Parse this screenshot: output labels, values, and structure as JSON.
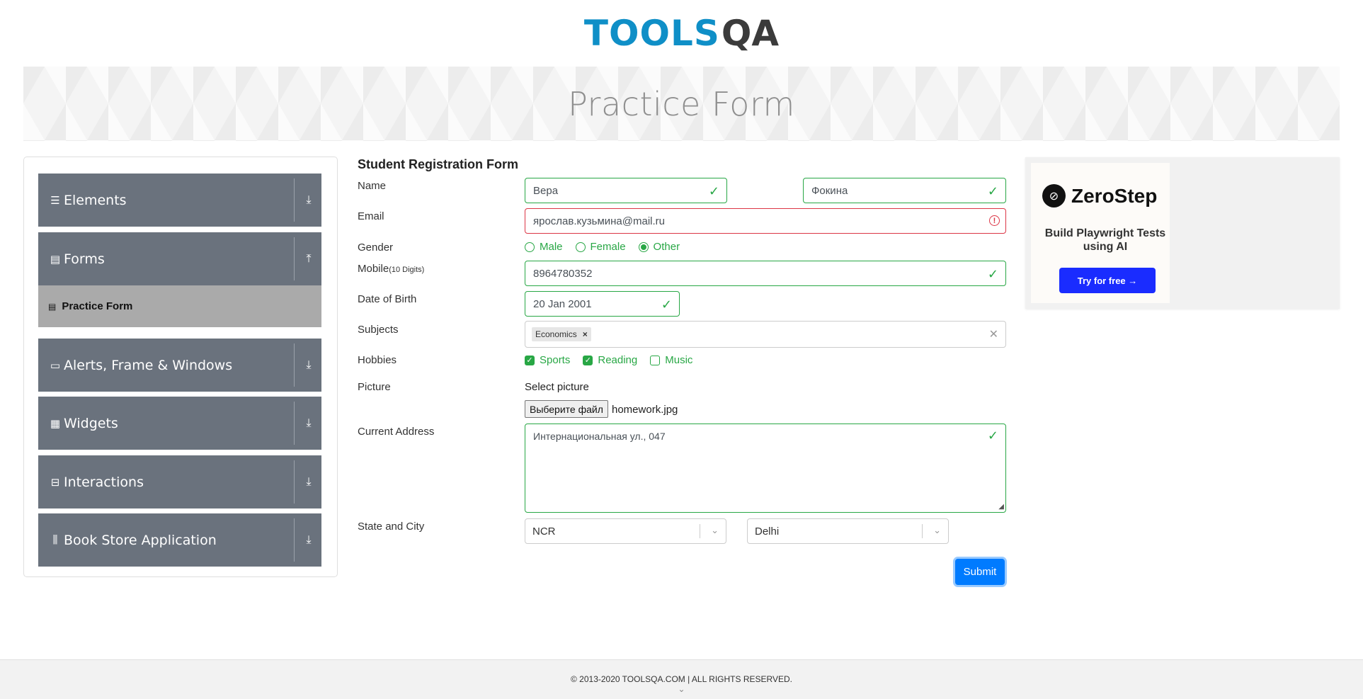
{
  "logo": {
    "text": "TOOLS",
    "qa": "QA"
  },
  "banner": {
    "title": "Practice Form"
  },
  "sidebar": {
    "groups": [
      {
        "label": "Elements",
        "icon": "☰",
        "arrow": "⤓"
      },
      {
        "label": "Forms",
        "icon": "▤",
        "arrow": "⤒"
      },
      {
        "label": "Alerts, Frame & Windows",
        "icon": "▭",
        "arrow": "⤓"
      },
      {
        "label": "Widgets",
        "icon": "▦",
        "arrow": "⤓"
      },
      {
        "label": "Interactions",
        "icon": "⊟",
        "arrow": "⤓"
      },
      {
        "label": "Book Store Application",
        "icon": "⫼",
        "arrow": "⤓"
      }
    ],
    "active_item": {
      "label": "Practice Form",
      "icon": "▤"
    }
  },
  "form": {
    "title": "Student Registration Form",
    "labels": {
      "name": "Name",
      "email": "Email",
      "gender": "Gender",
      "mobile": "Mobile",
      "mobile_hint": "(10 Digits)",
      "dob": "Date of Birth",
      "subjects": "Subjects",
      "hobbies": "Hobbies",
      "picture": "Picture",
      "address": "Current Address",
      "state_city": "State and City"
    },
    "first_name": "Вера",
    "last_name": "Фокина",
    "email": "ярослав.кузьмина@mail.ru",
    "gender_options": {
      "male": "Male",
      "female": "Female",
      "other": "Other"
    },
    "gender_selected": "Other",
    "mobile": "8964780352",
    "dob": "20 Jan 2001",
    "subject_chip": "Economics",
    "hobbies": {
      "sports": "Sports",
      "reading": "Reading",
      "music": "Music"
    },
    "hobbies_checked": [
      "Sports",
      "Reading"
    ],
    "picture_label": "Select picture",
    "file_button": "Выберите файл",
    "file_name": "homework.jpg",
    "address": "Интернациональная ул., 047",
    "state": "NCR",
    "city": "Delhi",
    "submit": "Submit"
  },
  "ad": {
    "brand": "ZeroStep",
    "copy": "Build Playwright Tests using AI",
    "button": "Try for free →"
  },
  "footer": {
    "copyright": "© 2013-2020 TOOLSQA.COM | ALL RIGHTS RESERVED."
  },
  "colors": {
    "valid": "#28a745",
    "invalid": "#dc3545",
    "primary": "#007bff",
    "sidebar": "#6a727d"
  }
}
